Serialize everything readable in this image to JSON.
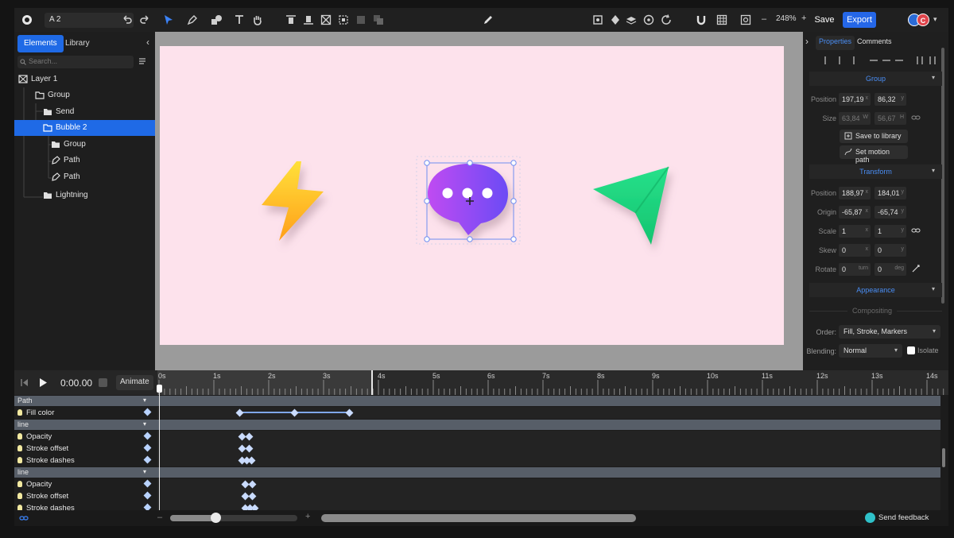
{
  "toolbar": {
    "doc_name": "A 2",
    "zoom": "248%",
    "save_label": "Save",
    "export_label": "Export",
    "avatars": [
      "",
      "C"
    ]
  },
  "left_panel": {
    "tabs": [
      "Elements",
      "Library"
    ],
    "search_placeholder": "Search...",
    "tree": [
      {
        "label": "Layer 1",
        "icon": "layer-icon"
      },
      {
        "label": "Group",
        "icon": "folder-icon"
      },
      {
        "label": "Send",
        "icon": "folder-icon"
      },
      {
        "label": "Bubble 2",
        "icon": "folder-icon",
        "selected": true
      },
      {
        "label": "Group",
        "icon": "folder-icon"
      },
      {
        "label": "Path",
        "icon": "path-icon"
      },
      {
        "label": "Path",
        "icon": "path-icon"
      },
      {
        "label": "Lightning",
        "icon": "folder-icon"
      }
    ]
  },
  "right_panel": {
    "tabs": [
      "Properties",
      "Comments"
    ],
    "group_section": "Group",
    "group_position": {
      "label": "Position",
      "x": "197,19",
      "y": "86,32"
    },
    "group_size": {
      "label": "Size",
      "w": "63,84",
      "h": "56,67"
    },
    "save_to_library": "Save to library",
    "set_motion_path": "Set motion path",
    "transform_section": "Transform",
    "transform": {
      "position": {
        "label": "Position",
        "x": "188,97",
        "y": "184,01"
      },
      "origin": {
        "label": "Origin",
        "x": "-65,87",
        "y": "-65,74"
      },
      "scale": {
        "label": "Scale",
        "x": "1",
        "y": "1"
      },
      "skew": {
        "label": "Skew",
        "x": "0",
        "y": "0"
      },
      "rotate": {
        "label": "Rotate",
        "x": "0",
        "y": "0",
        "x_unit": "turn",
        "y_unit": "deg"
      }
    },
    "appearance_section": "Appearance",
    "compositing_label": "Compositing",
    "order": {
      "label": "Order:",
      "value": "Fill, Stroke, Markers"
    },
    "blending": {
      "label": "Blending:",
      "value": "Normal",
      "isolate_label": "Isolate"
    }
  },
  "timeline": {
    "time": "0:00.00",
    "animate_label": "Animate",
    "ticks": [
      "0s",
      "1s",
      "2s",
      "3s",
      "4s",
      "5s",
      "6s",
      "7s",
      "8s",
      "9s",
      "10s",
      "11s",
      "12s",
      "13s",
      "14s"
    ],
    "groups": [
      {
        "header": "Path",
        "rows": [
          {
            "label": "Fill color"
          }
        ]
      },
      {
        "header": "line",
        "rows": [
          {
            "label": "Opacity"
          },
          {
            "label": "Stroke offset"
          },
          {
            "label": "Stroke dashes"
          }
        ]
      },
      {
        "header": "line",
        "rows": [
          {
            "label": "Opacity"
          },
          {
            "label": "Stroke offset"
          },
          {
            "label": "Stroke dashes"
          }
        ]
      }
    ]
  },
  "bottom": {
    "feedback_label": "Send feedback"
  },
  "colors": {
    "accent": "#2567e8",
    "selection": "#1f6ae6",
    "artboard": "#fde2ec",
    "link": "#4a8ef5"
  }
}
